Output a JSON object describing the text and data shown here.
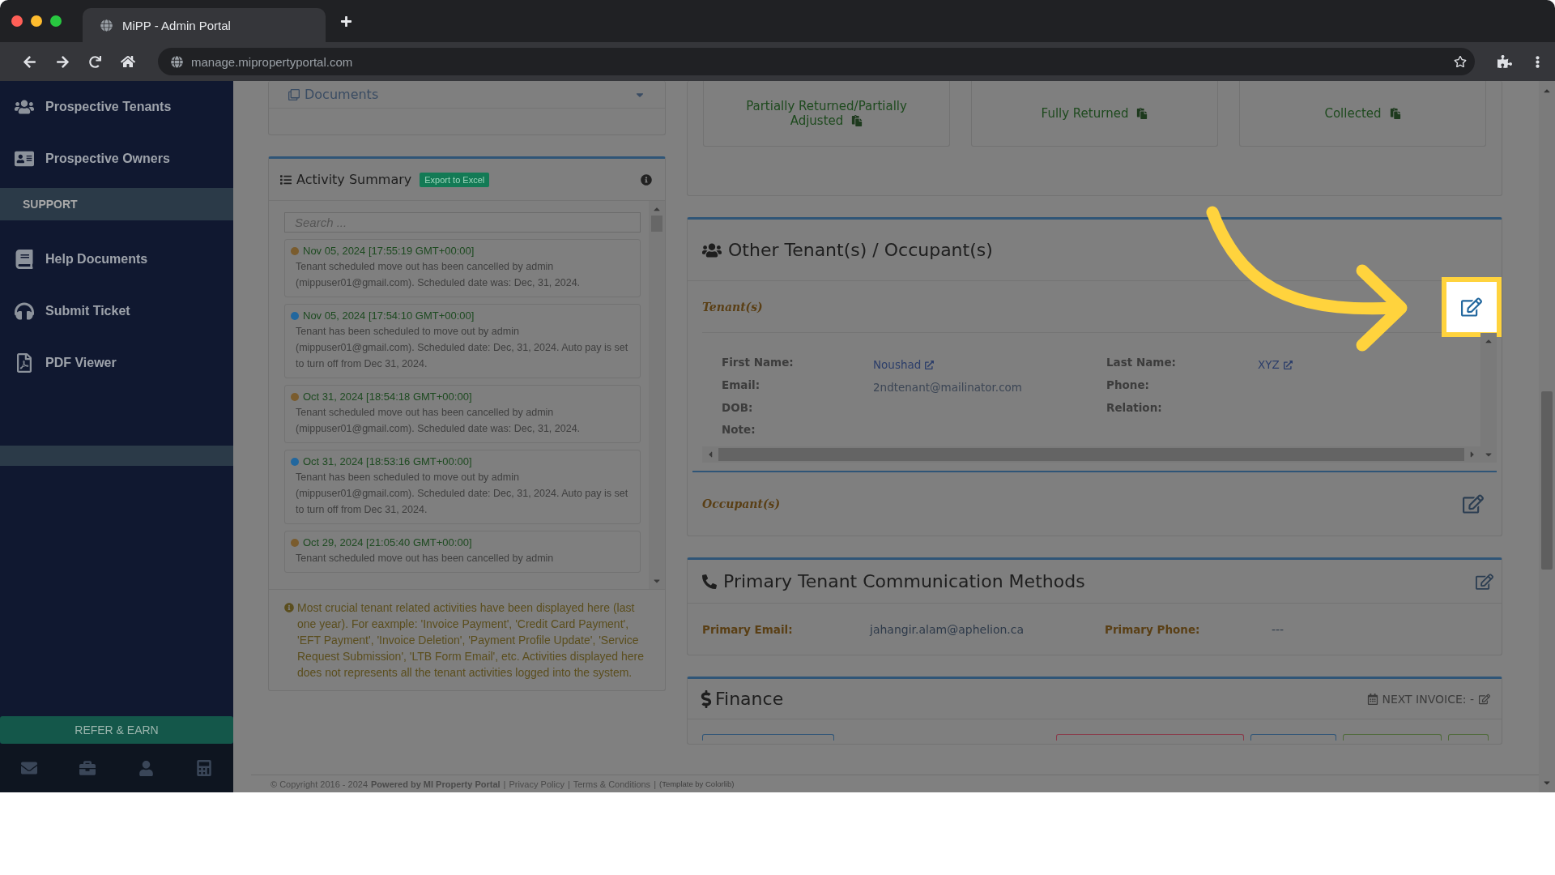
{
  "browser": {
    "tab_title": "MiPP - Admin Portal",
    "url": "manage.mipropertyportal.com"
  },
  "sidebar": {
    "items": [
      {
        "kind": "item",
        "label": "Prospective Tenants"
      },
      {
        "kind": "item",
        "label": "Prospective Owners"
      },
      {
        "kind": "header",
        "label": "SUPPORT"
      },
      {
        "kind": "item",
        "label": "Help Documents"
      },
      {
        "kind": "item",
        "label": "Submit Ticket"
      },
      {
        "kind": "item",
        "label": "PDF Viewer"
      },
      {
        "kind": "band"
      }
    ],
    "refer_button": "REFER & EARN"
  },
  "documents": {
    "title": "Documents"
  },
  "activity": {
    "title": "Activity Summary",
    "export_button": "Export to Excel",
    "search": {
      "placeholder": "Search ..."
    },
    "entries": [
      {
        "time": "Nov 05, 2024 [17:55:19 GMT+00:00]",
        "text": "Tenant scheduled move out has been cancelled by admin (mippuser01@gmail.com). Scheduled date was: Dec, 31, 2024.",
        "color": "#7a5c2e"
      },
      {
        "time": "Nov 05, 2024 [17:54:10 GMT+00:00]",
        "text": "Tenant has been scheduled to move out by admin (mippuser01@gmail.com). Scheduled date: Dec, 31, 2024. Auto pay is set to turn off from Dec 31, 2024.",
        "color": "#22679e"
      },
      {
        "time": "Oct 31, 2024 [18:54:18 GMT+00:00]",
        "text": "Tenant scheduled move out has been cancelled by admin (mippuser01@gmail.com). Scheduled date was: Dec, 31, 2024.",
        "color": "#7a5c2e"
      },
      {
        "time": "Oct 31, 2024 [18:53:16 GMT+00:00]",
        "text": "Tenant has been scheduled to move out by admin (mippuser01@gmail.com). Scheduled date: Dec, 31, 2024. Auto pay is set to turn off from Dec 31, 2024.",
        "color": "#22679e"
      },
      {
        "time": "Oct 29, 2024 [21:05:40 GMT+00:00]",
        "text": "Tenant scheduled move out has been cancelled by admin",
        "color": "#7a5c2e"
      }
    ],
    "note": "Most crucial tenant related activities have been displayed here (last one year). For eaxmple: 'Invoice Payment', 'Credit Card Payment', 'EFT Payment', 'Invoice Deletion', 'Payment Profile Update', 'Service Request Submission', 'LTB Form Email', etc. Activities displayed here does not represents all the tenant activities logged into the system."
  },
  "deposit_statuses": [
    "Partially Returned/Partially Adjusted",
    "Fully Returned",
    "Collected"
  ],
  "other_tenants": {
    "title": "Other Tenant(s) / Occupant(s)",
    "tenants_label": "Tenant(s)",
    "left_fields": [
      {
        "label": "First Name:",
        "value": "Noushad",
        "link": true
      },
      {
        "label": "Email:",
        "value": "2ndtenant@mailinator.com",
        "link": false
      },
      {
        "label": "DOB:"
      },
      {
        "label": "Note:"
      }
    ],
    "right_fields": [
      {
        "label": "Last Name:",
        "value": "XYZ",
        "link": true
      },
      {
        "label": "Phone:"
      },
      {
        "label": "Relation:"
      }
    ],
    "occupants_label": "Occupant(s)"
  },
  "communication": {
    "title": "Primary Tenant Communication Methods",
    "fields": [
      {
        "label": "Primary Email:",
        "value": "jahangir.alam@aphelion.ca"
      },
      {
        "label": "Primary Phone:",
        "value": "---"
      }
    ]
  },
  "finance": {
    "title": "Finance",
    "next_invoice": "NEXT INVOICE: -"
  },
  "footer": {
    "copyright": "© Copyright 2016 - 2024",
    "powered": "Powered by MI Property Portal",
    "separator": "|",
    "privacy": "Privacy Policy",
    "terms": "Terms & Conditions",
    "template": "(Template by Colorlib)"
  }
}
